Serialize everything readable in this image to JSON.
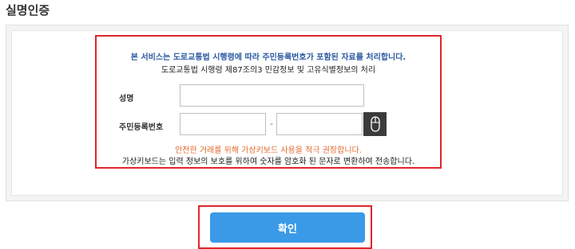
{
  "section": {
    "title": "실명인증"
  },
  "notice": {
    "primary": "본 서비스는 도로교통법 시행령에 따라 주민등록번호가 포함된 자료를 처리합니다.",
    "secondary": "도로교통법 시행령 제87조의3 민감정보 및 고유식별정보의 처리"
  },
  "form": {
    "name_label": "성명",
    "name_value": "",
    "rrn_label": "주민등록번호",
    "rrn_front_value": "",
    "rrn_back_value": "",
    "separator": "-",
    "keyboard_icon": "mouse-icon"
  },
  "messages": {
    "warning": "안전한 거래를 위해 가상키보드 사용을 적극 권장합니다.",
    "info": "가상키보드는 입력 정보의 보호를 위하여 숫자를 암호화 된 문자로 변환하여 전송합니다."
  },
  "actions": {
    "confirm_label": "확인"
  },
  "colors": {
    "highlight": "#e0262c",
    "notice": "#2b59a3",
    "warning": "#e36a2d",
    "button": "#3a9ae8",
    "keyboard_button": "#3b3b3b"
  }
}
